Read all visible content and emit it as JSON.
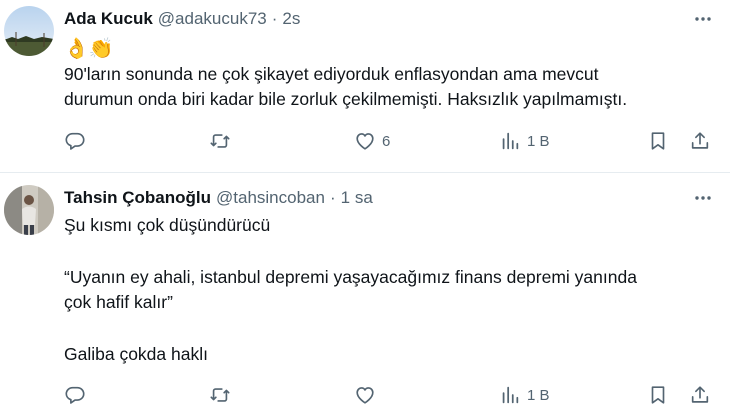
{
  "tweets": [
    {
      "name": "Ada Kucuk",
      "handle": "@adakucuk73",
      "separator": "·",
      "time": "2s",
      "emoji": "👌👏",
      "lines": [
        "90'ların sonunda ne çok şikayet ediyorduk enflasyondan ama mevcut",
        "durumun onda biri kadar bile zorluk çekilmemişti. Haksızlık yapılmamıştı."
      ],
      "likes": "6",
      "views": "1 B"
    },
    {
      "name": "Tahsin Çobanoğlu",
      "handle": "@tahsincoban",
      "separator": "·",
      "time": "1 sa",
      "lines": [
        "Şu kısmı çok düşündürücü",
        "“Uyanın ey ahali, istanbul depremi yaşayacağımız finans depremi yanında",
        "çok hafif kalır”",
        "Galiba çokda haklı"
      ],
      "likes": "",
      "views": "1 B"
    }
  ],
  "icons": {
    "more": "more-dots-icon",
    "reply": "reply-bubble-icon",
    "retweet": "retweet-icon",
    "like": "heart-icon",
    "views": "views-bar-chart-icon",
    "bookmark": "bookmark-icon",
    "share": "share-upload-icon"
  },
  "colors": {
    "text": "#0f1419",
    "secondary": "#536471",
    "divider": "#e6ecf0"
  }
}
